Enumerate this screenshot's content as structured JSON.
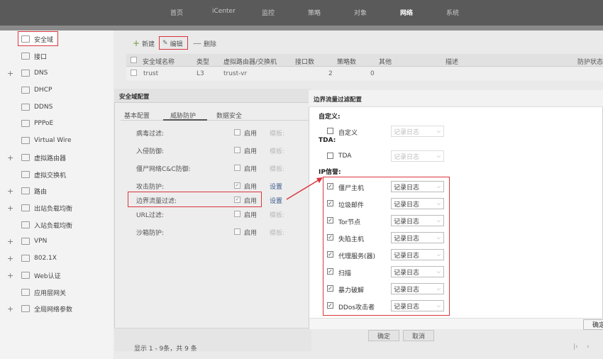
{
  "topnav": {
    "items": [
      {
        "label": "首页"
      },
      {
        "label": "iCenter"
      },
      {
        "label": "监控"
      },
      {
        "label": "策略"
      },
      {
        "label": "对象"
      },
      {
        "label": "网络"
      },
      {
        "label": "系统"
      }
    ],
    "active": "网络"
  },
  "sidebar": {
    "items": [
      {
        "label": "安全域",
        "plus": "",
        "icon": "zone-icon"
      },
      {
        "label": "接口",
        "plus": "",
        "icon": "interface-icon"
      },
      {
        "label": "DNS",
        "plus": "+",
        "icon": "dns-icon"
      },
      {
        "label": "DHCP",
        "plus": "",
        "icon": "dhcp-icon"
      },
      {
        "label": "DDNS",
        "plus": "",
        "icon": "ddns-icon"
      },
      {
        "label": "PPPoE",
        "plus": "",
        "icon": "pppoe-icon"
      },
      {
        "label": "Virtual Wire",
        "plus": "",
        "icon": "virtual-wire-icon"
      },
      {
        "label": "虚拟路由器",
        "plus": "+",
        "icon": "virtual-router-icon"
      },
      {
        "label": "虚拟交换机",
        "plus": "",
        "icon": "virtual-switch-icon"
      },
      {
        "label": "路由",
        "plus": "+",
        "icon": "route-icon"
      },
      {
        "label": "出站负载均衡",
        "plus": "+",
        "icon": "outbound-lb-icon"
      },
      {
        "label": "入站负载均衡",
        "plus": "",
        "icon": "inbound-lb-icon"
      },
      {
        "label": "VPN",
        "plus": "+",
        "icon": "vpn-icon"
      },
      {
        "label": "802.1X",
        "plus": "+",
        "icon": "dot1x-icon"
      },
      {
        "label": "Web认证",
        "plus": "+",
        "icon": "web-auth-icon"
      },
      {
        "label": "应用层网关",
        "plus": "",
        "icon": "alg-icon"
      },
      {
        "label": "全局网络参数",
        "plus": "+",
        "icon": "global-params-icon"
      }
    ]
  },
  "toolbar": {
    "new_label": "新建",
    "edit_label": "编辑",
    "delete_label": "删除"
  },
  "table": {
    "headers": [
      "安全域名称",
      "类型",
      "虚拟路由器/交换机",
      "接口数",
      "策略数",
      "其他",
      "描述",
      "防护状态"
    ],
    "rows": [
      {
        "name": "trust",
        "type": "L3",
        "vr": "trust-vr",
        "ifcount": "2",
        "policy": "0"
      }
    ]
  },
  "zone_dialog": {
    "title": "安全域配置",
    "tabs": [
      "基本配置",
      "威胁防护",
      "数据安全"
    ],
    "rows": [
      {
        "label": "病毒过滤:",
        "enable": "启用",
        "right": "模板:",
        "checked": false
      },
      {
        "label": "入侵防御:",
        "enable": "启用",
        "right": "模板:",
        "checked": false
      },
      {
        "label": "僵尸网络C&C防御:",
        "enable": "启用",
        "right": "模板:",
        "checked": false
      },
      {
        "label": "攻击防护:",
        "enable": "启用",
        "right": "设置",
        "checked": true
      },
      {
        "label": "边界流量过滤:",
        "enable": "启用",
        "right": "设置",
        "checked": true
      },
      {
        "label": "URL过滤:",
        "enable": "启用",
        "right": "模板:",
        "checked": false
      },
      {
        "label": "沙箱防护:",
        "enable": "启用",
        "right": "模板:",
        "checked": false
      }
    ],
    "ok_label": "确定",
    "cancel_label": "取消",
    "page_info": "显示 1 - 9条，共 9 条"
  },
  "boundary_dialog": {
    "title": "边界流量过滤配置",
    "custom_heading": "自定义:",
    "custom_option": {
      "label": "自定义",
      "value": "记录日志"
    },
    "tda_heading": "TDA:",
    "tda_option": {
      "label": "TDA",
      "value": "记录日志"
    },
    "ip_heading": "IP信誉:",
    "ip_options": [
      {
        "label": "僵尸主机",
        "value": "记录日志"
      },
      {
        "label": "垃圾邮件",
        "value": "记录日志"
      },
      {
        "label": "Tor节点",
        "value": "记录日志"
      },
      {
        "label": "失陷主机",
        "value": "记录日志"
      },
      {
        "label": "代理服务(器)",
        "value": "记录日志"
      },
      {
        "label": "扫描",
        "value": "记录日志"
      },
      {
        "label": "暴力破解",
        "value": "记录日志"
      },
      {
        "label": "DDos攻击者",
        "value": "记录日志"
      }
    ],
    "ok_label": "确定"
  },
  "colors": {
    "highlight": "#d9363e",
    "topnav": "#5a5a5a",
    "link": "#3a5a8c"
  }
}
